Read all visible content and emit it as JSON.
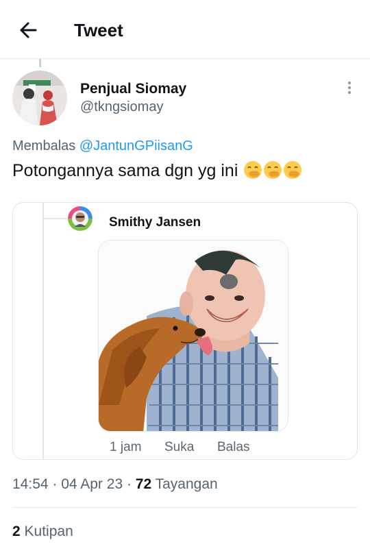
{
  "header": {
    "title": "Tweet"
  },
  "tweet": {
    "author_name": "Penjual Siomay",
    "author_handle": "@tkngsiomay",
    "replying_prefix": "Membalas",
    "replying_to": "@JantunGPiisanG",
    "text": "Potongannya sama dgn yg ini",
    "emoji": [
      "hand-over-mouth-emoji",
      "hand-over-mouth-emoji",
      "hand-over-mouth-emoji"
    ],
    "timestamp": "14:54 · 04 Apr 23 ·",
    "views_count": "72",
    "views_label": "Tayangan",
    "quotes_count": "2",
    "quotes_label": "Kutipan"
  },
  "quoted_reply": {
    "name": "Smithy Jansen",
    "time": "1 jam",
    "like_label": "Suka",
    "reply_label": "Balas"
  },
  "icons": {
    "back": "arrow-left-icon",
    "more": "more-vertical-icon"
  },
  "colors": {
    "link": "#1d9bf0",
    "text": "#0f1419",
    "secondary_text": "#536471",
    "divider": "#e6ecf0"
  }
}
